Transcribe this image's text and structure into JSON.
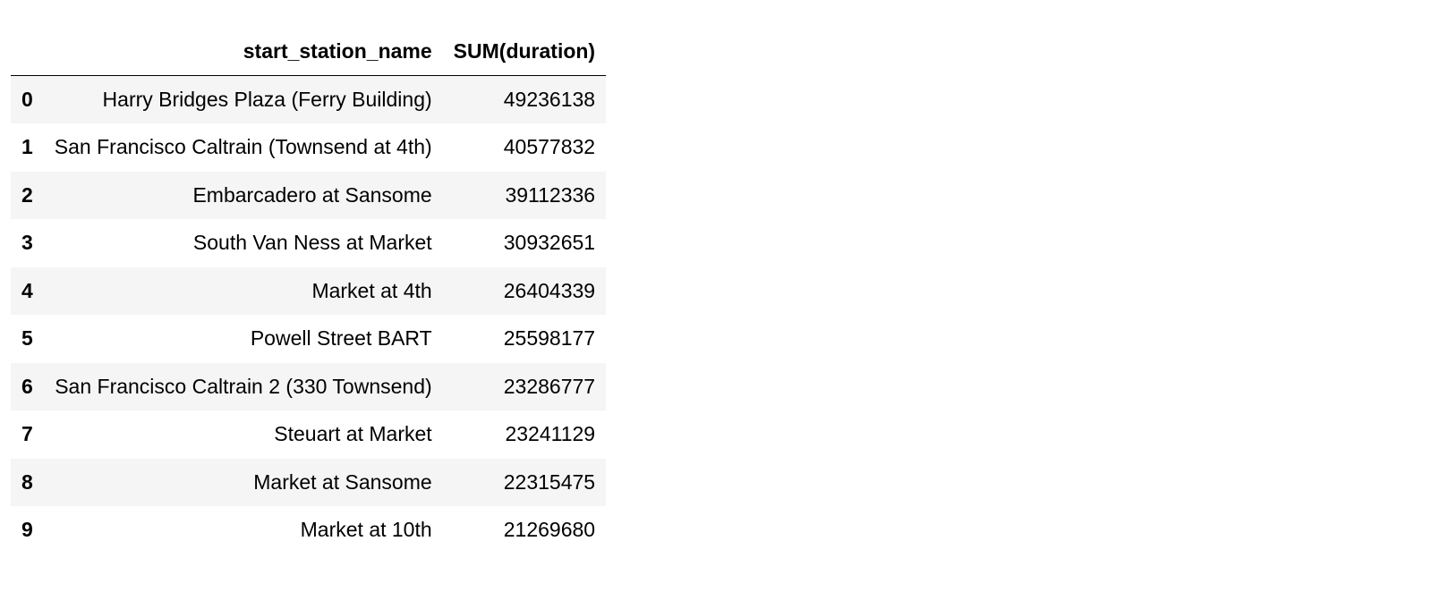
{
  "table": {
    "columns": [
      "",
      "start_station_name",
      "SUM(duration)"
    ],
    "rows": [
      {
        "index": "0",
        "start_station_name": "Harry Bridges Plaza (Ferry Building)",
        "sum_duration": "49236138"
      },
      {
        "index": "1",
        "start_station_name": "San Francisco Caltrain (Townsend at 4th)",
        "sum_duration": "40577832"
      },
      {
        "index": "2",
        "start_station_name": "Embarcadero at Sansome",
        "sum_duration": "39112336"
      },
      {
        "index": "3",
        "start_station_name": "South Van Ness at Market",
        "sum_duration": "30932651"
      },
      {
        "index": "4",
        "start_station_name": "Market at 4th",
        "sum_duration": "26404339"
      },
      {
        "index": "5",
        "start_station_name": "Powell Street BART",
        "sum_duration": "25598177"
      },
      {
        "index": "6",
        "start_station_name": "San Francisco Caltrain 2 (330 Townsend)",
        "sum_duration": "23286777"
      },
      {
        "index": "7",
        "start_station_name": "Steuart at Market",
        "sum_duration": "23241129"
      },
      {
        "index": "8",
        "start_station_name": "Market at Sansome",
        "sum_duration": "22315475"
      },
      {
        "index": "9",
        "start_station_name": "Market at 10th",
        "sum_duration": "21269680"
      }
    ]
  }
}
